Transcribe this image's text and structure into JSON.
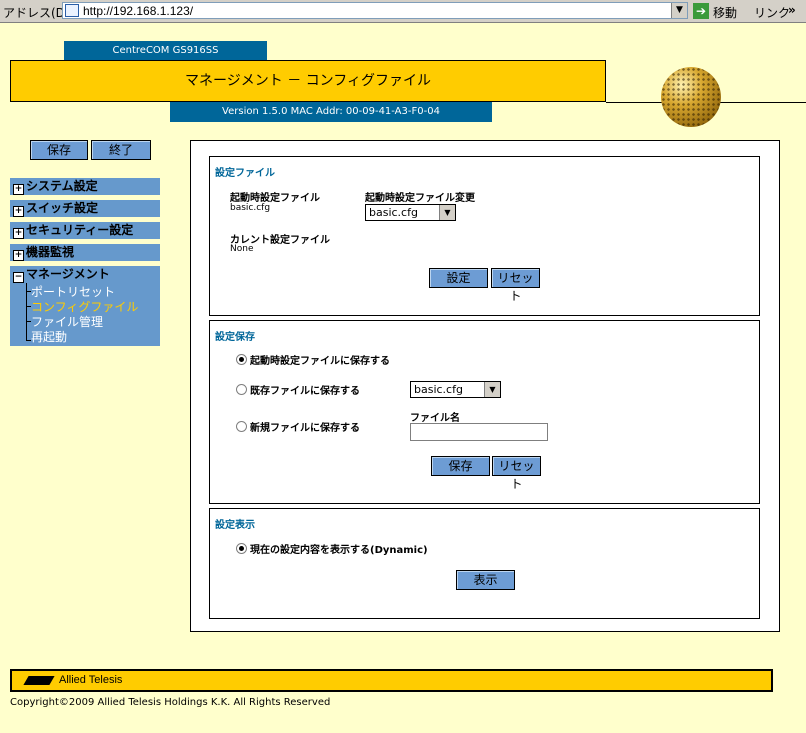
{
  "browser": {
    "address_label": "アドレス(D)",
    "url": "http://192.168.1.123/",
    "go_label": "移動",
    "links_label": "リンク",
    "links_chevron": "»"
  },
  "header": {
    "model": "CentreCOM GS916SS",
    "title": "マネージメント － コンフィグファイル",
    "version": "Version 1.5.0 MAC Addr: 00-09-41-A3-F0-04"
  },
  "sidebar": {
    "save_label": "保存",
    "exit_label": "終了",
    "menus": [
      {
        "label": "システム設定",
        "expand": "+"
      },
      {
        "label": "スイッチ設定",
        "expand": "+"
      },
      {
        "label": "セキュリティー設定",
        "expand": "+"
      },
      {
        "label": "機器監視",
        "expand": "+"
      },
      {
        "label": "マネージメント",
        "expand": "−"
      }
    ],
    "sub_items": [
      {
        "label": "ポートリセット",
        "color": "#ffffff"
      },
      {
        "label": "コンフィグファイル",
        "color": "#ffcc00"
      },
      {
        "label": "ファイル管理",
        "color": "#ffffff"
      },
      {
        "label": "再起動",
        "color": "#ffffff"
      }
    ]
  },
  "config_file": {
    "title": "設定ファイル",
    "startup_label": "起動時設定ファイル",
    "startup_value": "basic.cfg",
    "change_label": "起動時設定ファイル変更",
    "change_selected": "basic.cfg",
    "current_label": "カレント設定ファイル",
    "current_value": "None",
    "set_button": "設定",
    "reset_button": "リセット"
  },
  "config_save": {
    "title": "設定保存",
    "option_startup": "起動時設定ファイルに保存する",
    "option_existing": "既存ファイルに保存する",
    "existing_selected": "basic.cfg",
    "option_new": "新規ファイルに保存する",
    "filename_label": "ファイル名",
    "filename_value": "",
    "save_button": "保存",
    "reset_button": "リセット"
  },
  "config_display": {
    "title": "設定表示",
    "option_current": "現在の設定内容を表示する(Dynamic)",
    "show_button": "表示"
  },
  "footer": {
    "logo_text": "Allied Telesis",
    "copyright": "Copyright©2009 Allied Telesis Holdings K.K. All Rights Reserved"
  },
  "colors": {
    "background": "#ffffcc",
    "accent_yellow": "#ffcc00",
    "accent_blue": "#006699",
    "menu_blue": "#6699cc",
    "button_blue": "#6d9cd4"
  }
}
